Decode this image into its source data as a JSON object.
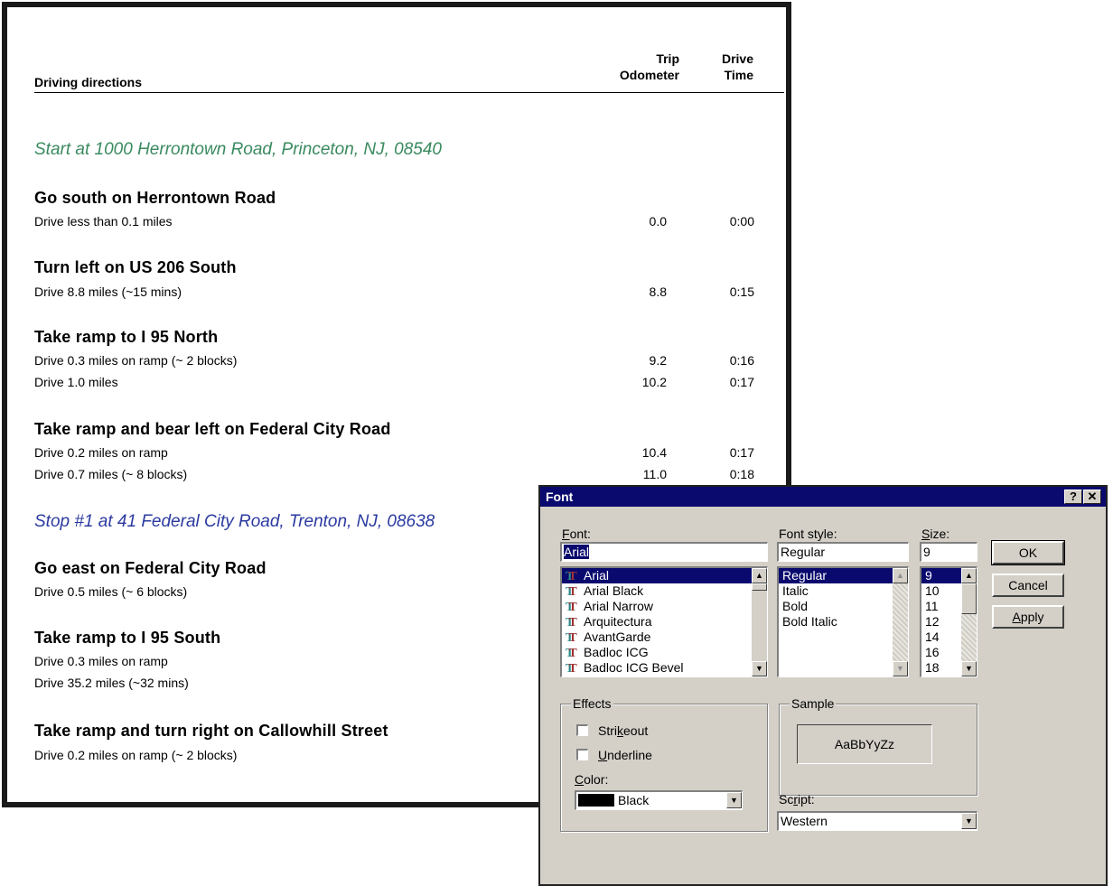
{
  "header": {
    "directions_label": "Driving directions",
    "trip_odometer_label": [
      "Trip",
      "Odometer"
    ],
    "drive_time_label": [
      "Drive",
      "Time"
    ]
  },
  "start": "Start at 1000 Herrontown Road, Princeton, NJ, 08540",
  "stop1": "Stop #1 at 41 Federal City Road, Trenton, NJ, 08638",
  "steps": [
    {
      "title": "Go south on Herrontown Road",
      "rows": [
        {
          "desc": "Drive less than 0.1 miles",
          "odo": "0.0",
          "time": "0:00"
        }
      ]
    },
    {
      "title": "Turn left on US 206 South",
      "rows": [
        {
          "desc": "Drive 8.8 miles (~15 mins)",
          "odo": "8.8",
          "time": "0:15"
        }
      ]
    },
    {
      "title": "Take ramp to I 95 North",
      "rows": [
        {
          "desc": "Drive 0.3 miles on ramp (~ 2 blocks)",
          "odo": "9.2",
          "time": "0:16"
        },
        {
          "desc": "Drive 1.0 miles",
          "odo": "10.2",
          "time": "0:17"
        }
      ]
    },
    {
      "title": "Take ramp and bear left on Federal City Road",
      "rows": [
        {
          "desc": "Drive 0.2 miles on ramp",
          "odo": "10.4",
          "time": "0:17"
        },
        {
          "desc": "Drive 0.7 miles (~ 8 blocks)",
          "odo": "11.0",
          "time": "0:18"
        }
      ]
    },
    {
      "title": "Go east on Federal City Road",
      "rows": [
        {
          "desc": "Drive 0.5 miles (~ 6 blocks)",
          "odo": "",
          "time": ""
        }
      ]
    },
    {
      "title": "Take ramp to I 95 South",
      "rows": [
        {
          "desc": "Drive 0.3 miles on ramp",
          "odo": "",
          "time": ""
        },
        {
          "desc": "Drive 35.2 miles (~32 mins)",
          "odo": "",
          "time": ""
        }
      ]
    },
    {
      "title": "Take ramp and turn right on Callowhill Street",
      "rows": [
        {
          "desc": "Drive 0.2 miles on ramp (~ 2 blocks)",
          "odo": "",
          "time": ""
        }
      ]
    }
  ],
  "dialog": {
    "title": "Font",
    "help_btn": "?",
    "close_btn": "✕",
    "font_label": "Font:",
    "font_value": "Arial",
    "font_list": [
      "Arial",
      "Arial Black",
      "Arial Narrow",
      "Arquitectura",
      "AvantGarde",
      "Badloc ICG",
      "Badloc ICG Bevel"
    ],
    "font_list_icon": "truetype-icon",
    "style_label": "Font style:",
    "style_value": "Regular",
    "style_list": [
      "Regular",
      "Italic",
      "Bold",
      "Bold Italic"
    ],
    "size_label": "Size:",
    "size_value": "9",
    "size_list": [
      "9",
      "10",
      "11",
      "12",
      "14",
      "16",
      "18"
    ],
    "ok": "OK",
    "cancel": "Cancel",
    "apply": "Apply",
    "effects_label": "Effects",
    "strikeout": "Strikeout",
    "underline": "Underline",
    "strikeout_checked": false,
    "underline_checked": false,
    "color_label": "Color:",
    "color_value": "Black",
    "color_swatch": "#000000",
    "sample_label": "Sample",
    "sample_text": "AaBbYyZz",
    "script_label": "Script:",
    "script_value": "Western"
  },
  "colors": {
    "start_text": "#3a8a5f",
    "stop_text": "#2b3aa0",
    "titlebar": "#0a0a6e",
    "dialog_face": "#d4d0c8"
  }
}
